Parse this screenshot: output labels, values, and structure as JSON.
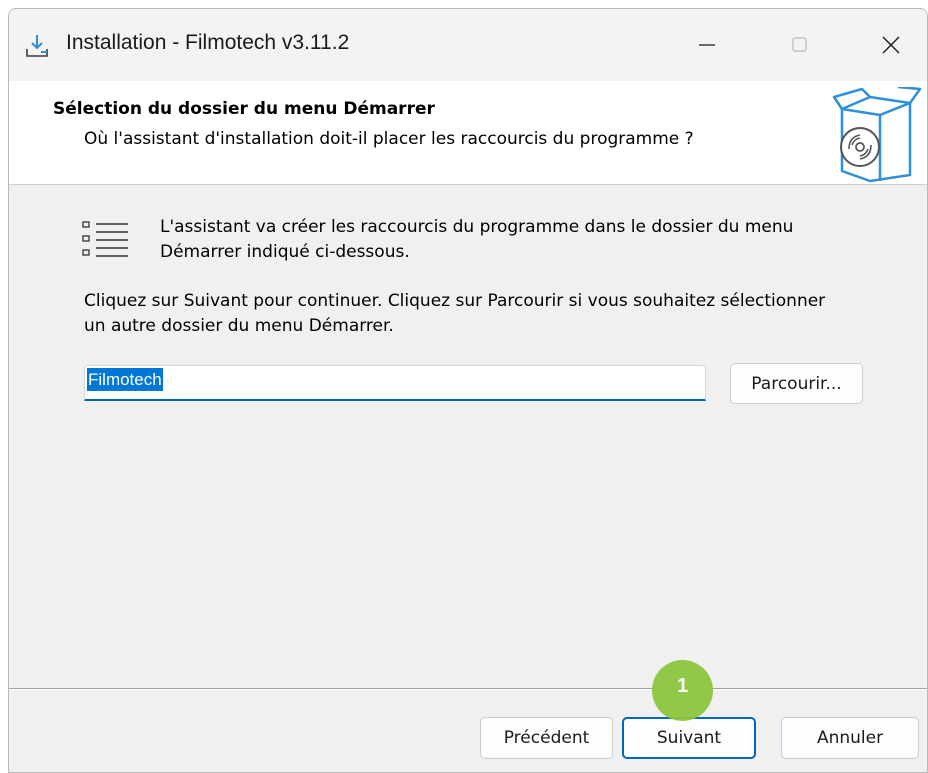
{
  "window": {
    "title": "Installation - Filmotech v3.11.2"
  },
  "header": {
    "title": "Sélection du dossier du menu Démarrer",
    "subtitle": "Où l'assistant d'installation doit-il placer les raccourcis du programme ?"
  },
  "content": {
    "intro": "L'assistant va créer les raccourcis du programme dans le dossier du menu Démarrer indiqué ci-dessous.",
    "instructions": "Cliquez sur Suivant pour continuer. Cliquez sur Parcourir si vous souhaitez sélectionner un autre dossier du menu Démarrer.",
    "folder_value": "Filmotech",
    "browse_label": "Parcourir..."
  },
  "footer": {
    "prev_label": "Précédent",
    "next_label": "Suivant",
    "cancel_label": "Annuler"
  },
  "annotation": {
    "step_number": "1",
    "color": "#8cc63f"
  },
  "icons": [
    "installer-icon",
    "minimize-icon",
    "maximize-icon",
    "close-icon",
    "software-box-icon",
    "list-icon"
  ],
  "colors": {
    "accent": "#0067c0",
    "selection": "#0078d4",
    "icon_blue": "#2f8fd8"
  }
}
